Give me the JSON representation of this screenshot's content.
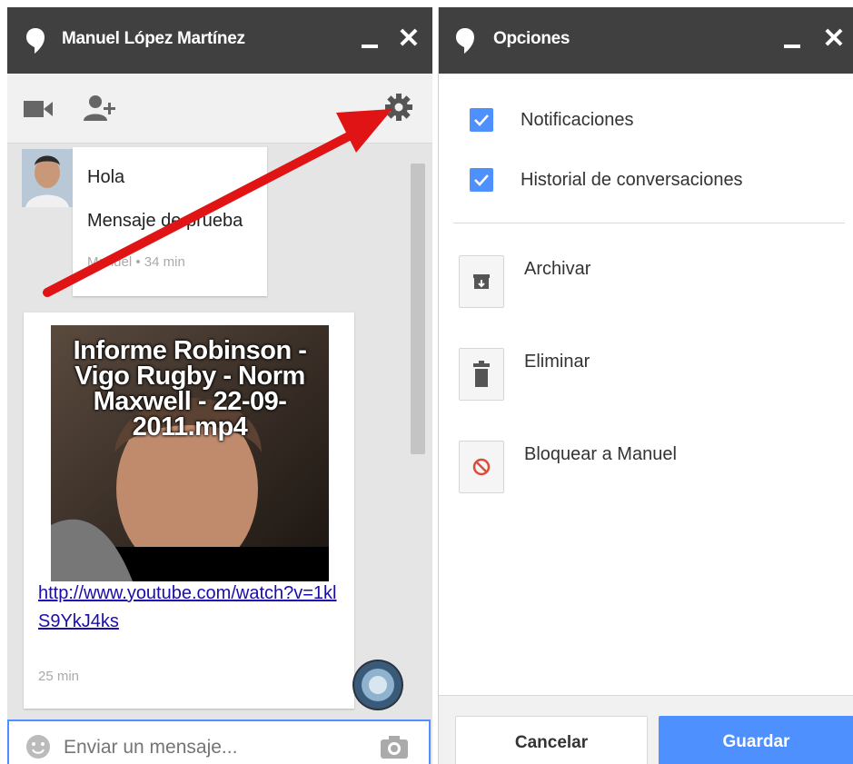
{
  "chat_window": {
    "title": "Manuel López Martínez",
    "minimize_icon": "minimize-icon",
    "close_label": "✕",
    "toolbar": {
      "video_icon": "video-camera-icon",
      "add_person_icon": "add-person-icon",
      "settings_icon": "gear-icon"
    },
    "messages": [
      {
        "lines": [
          "Hola",
          "Mensaje de prueba"
        ],
        "meta": "Manuel • 34 min"
      },
      {
        "video_title": "Informe Robinson - Vigo Rugby - Norm Maxwell - 22-09-2011.mp4",
        "link": "http://www.youtube.com/watch?v=1klS9YkJ4ks",
        "meta": "25 min"
      }
    ],
    "composer": {
      "placeholder": "Enviar un mensaje...",
      "emoji_icon": "smiley-icon",
      "camera_icon": "camera-icon"
    }
  },
  "options_window": {
    "title": "Opciones",
    "close_label": "✕",
    "checkboxes": [
      {
        "label": "Notificaciones",
        "checked": true
      },
      {
        "label": "Historial de conversaciones",
        "checked": true
      }
    ],
    "actions": [
      {
        "label": "Archivar",
        "icon": "archive-icon"
      },
      {
        "label": "Eliminar",
        "icon": "trash-icon"
      },
      {
        "label": "Bloquear a Manuel",
        "icon": "block-icon"
      }
    ],
    "buttons": {
      "cancel": "Cancelar",
      "save": "Guardar"
    }
  },
  "colors": {
    "titlebar": "#404040",
    "accent": "#4d90fe",
    "arrow": "#e01414",
    "block": "#dd4b39"
  }
}
